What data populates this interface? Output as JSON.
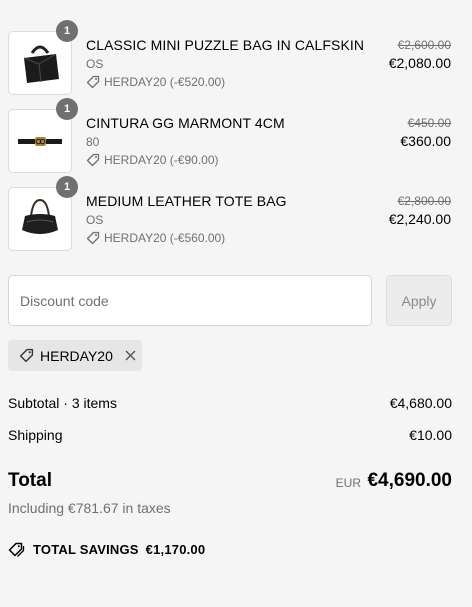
{
  "items": [
    {
      "quantity": "1",
      "title": "CLASSIC MINI PUZZLE BAG IN CALFSKIN",
      "variant": "OS",
      "discount": "HERDAY20 (-€520.00)",
      "original_price": "€2,600.00",
      "final_price": "€2,080.00",
      "image_icon": "puzzle-bag-image"
    },
    {
      "quantity": "1",
      "title": "CINTURA GG MARMONT 4CM",
      "variant": "80",
      "discount": "HERDAY20 (-€90.00)",
      "original_price": "€450.00",
      "final_price": "€360.00",
      "image_icon": "belt-image"
    },
    {
      "quantity": "1",
      "title": "MEDIUM LEATHER TOTE BAG",
      "variant": "OS",
      "discount": "HERDAY20 (-€560.00)",
      "original_price": "€2,800.00",
      "final_price": "€2,240.00",
      "image_icon": "tote-bag-image"
    }
  ],
  "discount_form": {
    "placeholder": "Discount code",
    "value": "",
    "apply_label": "Apply"
  },
  "applied_code": {
    "code": "HERDAY20",
    "icon": "tag-icon",
    "remove_icon": "close-icon"
  },
  "subtotal": {
    "label": "Subtotal · 3 items",
    "value": "€4,680.00"
  },
  "shipping": {
    "label": "Shipping",
    "value": "€10.00"
  },
  "total": {
    "label": "Total",
    "currency": "EUR",
    "value": "€4,690.00",
    "taxes_note": "Including €781.67 in taxes"
  },
  "savings": {
    "label": "TOTAL SAVINGS",
    "amount": "€1,170.00",
    "icon": "savings-tag-icon"
  },
  "colors": {
    "background": "#f5f5f5",
    "muted_text": "#707070",
    "badge": "#707070",
    "chip_background": "#e6e6e6"
  }
}
